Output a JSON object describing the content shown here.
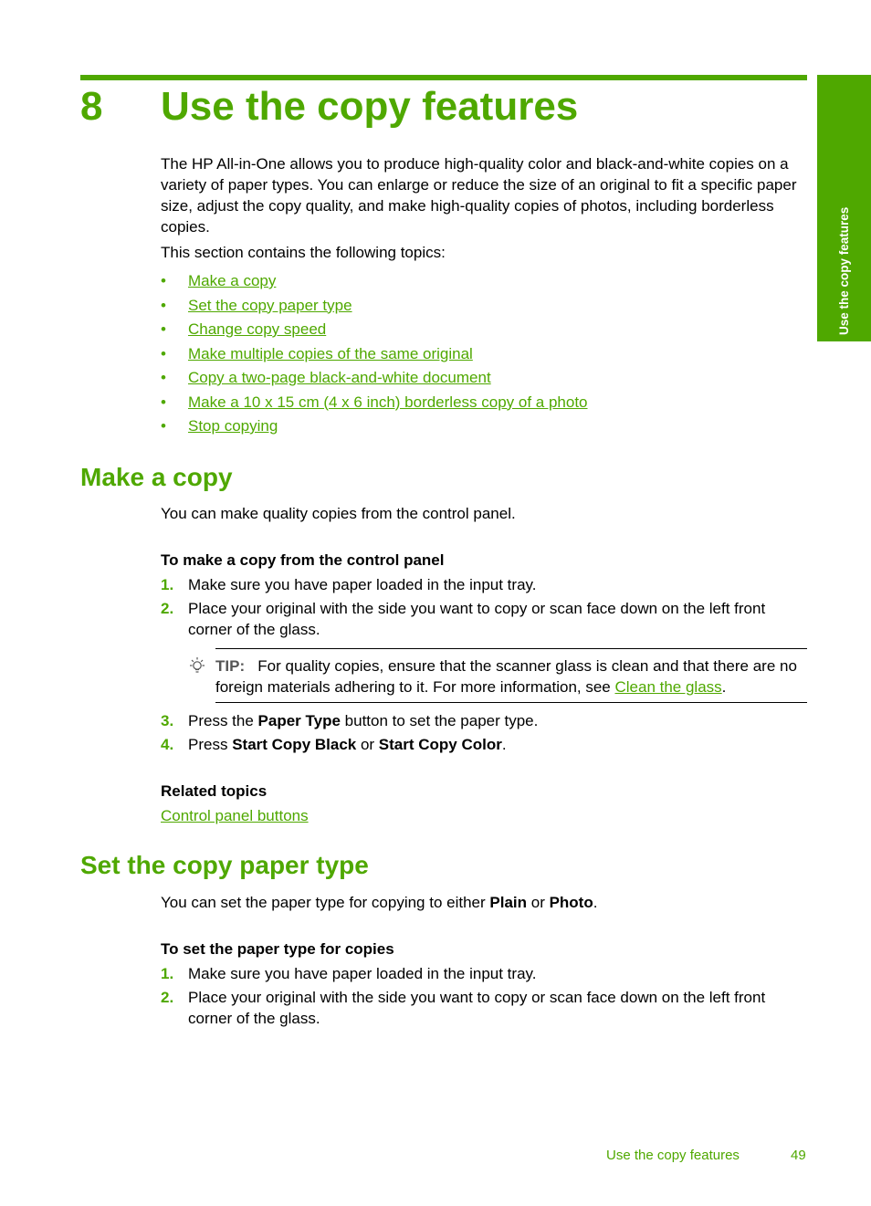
{
  "side_tab": "Use the copy features",
  "chapter": {
    "number": "8",
    "title": "Use the copy features"
  },
  "intro": "The HP All-in-One allows you to produce high-quality color and black-and-white copies on a variety of paper types. You can enlarge or reduce the size of an original to fit a specific paper size, adjust the copy quality, and make high-quality copies of photos, including borderless copies.",
  "topics_intro": "This section contains the following topics:",
  "bullet_glyph": "•",
  "topics": [
    "Make a copy",
    "Set the copy paper type",
    "Change copy speed",
    "Make multiple copies of the same original",
    "Copy a two-page black-and-white document",
    "Make a 10 x 15 cm (4 x 6 inch) borderless copy of a photo",
    "Stop copying"
  ],
  "make_copy": {
    "heading": "Make a copy",
    "intro": "You can make quality copies from the control panel.",
    "proc_title": "To make a copy from the control panel",
    "steps": [
      {
        "n": "1.",
        "text": "Make sure you have paper loaded in the input tray."
      },
      {
        "n": "2.",
        "text": "Place your original with the side you want to copy or scan face down on the left front corner of the glass."
      },
      {
        "n": "3.",
        "pre": "Press the ",
        "b1": "Paper Type",
        "post": " button to set the paper type."
      },
      {
        "n": "4.",
        "pre": "Press ",
        "b1": "Start Copy Black",
        "mid": " or ",
        "b2": "Start Copy Color",
        "post": "."
      }
    ],
    "tip": {
      "icon": "lightbulb-icon",
      "label": "TIP:",
      "text": "For quality copies, ensure that the scanner glass is clean and that there are no foreign materials adhering to it. For more information, see ",
      "link": "Clean the glass",
      "end": "."
    },
    "related_title": "Related topics",
    "related_link": "Control panel buttons"
  },
  "paper_type": {
    "heading": "Set the copy paper type",
    "intro_pre": "You can set the paper type for copying to either ",
    "b1": "Plain",
    "mid": " or ",
    "b2": "Photo",
    "end": ".",
    "proc_title": "To set the paper type for copies",
    "steps": [
      {
        "n": "1.",
        "text": "Make sure you have paper loaded in the input tray."
      },
      {
        "n": "2.",
        "text": "Place your original with the side you want to copy or scan face down on the left front corner of the glass."
      }
    ]
  },
  "footer": {
    "section": "Use the copy features",
    "page": "49"
  },
  "colors": {
    "accent": "#4fa800"
  }
}
